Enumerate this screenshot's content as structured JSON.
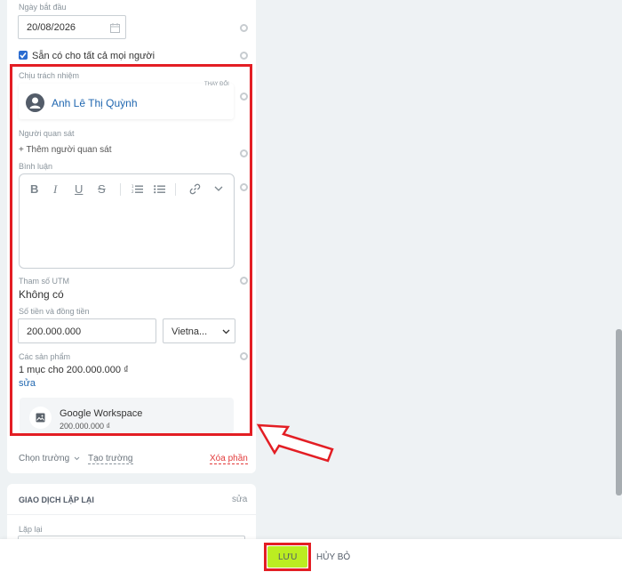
{
  "start_date": {
    "label": "Ngày bắt đầu",
    "value": "20/08/2026"
  },
  "available_all": {
    "label": "Sẵn có cho tất cả mọi người",
    "checked": true
  },
  "responsible": {
    "label": "Chịu trách nhiệm",
    "change": "THAY ĐỔI",
    "person": "Anh Lê Thị Quỳnh"
  },
  "observers": {
    "label": "Người quan sát",
    "add": "+ Thêm người quan sát"
  },
  "comment": {
    "label": "Bình luận"
  },
  "utm": {
    "label": "Tham số UTM",
    "value": "Không có"
  },
  "amount": {
    "label": "Số tiền và đồng tiền",
    "value": "200.000.000",
    "currency": "Vietna..."
  },
  "products": {
    "label": "Các sản phẩm",
    "summary": "1 mục cho 200.000.000 ₫",
    "edit": "sửa",
    "item": {
      "name": "Google Workspace",
      "price": "200.000.000 ₫"
    }
  },
  "footer_links": {
    "choose": "Chọn trường",
    "create": "Tạo trường",
    "delete": "Xóa phần"
  },
  "recurring": {
    "title": "GIAO DỊCH LẶP LẠI",
    "edit": "sửa",
    "label": "Lặp lại"
  },
  "actions": {
    "save": "LƯU",
    "cancel": "HỦY BỎ"
  },
  "colors": {
    "highlight": "#e31e24",
    "save_bg": "#bbed21",
    "link": "#2067b0",
    "delete": "#e23b3b"
  }
}
